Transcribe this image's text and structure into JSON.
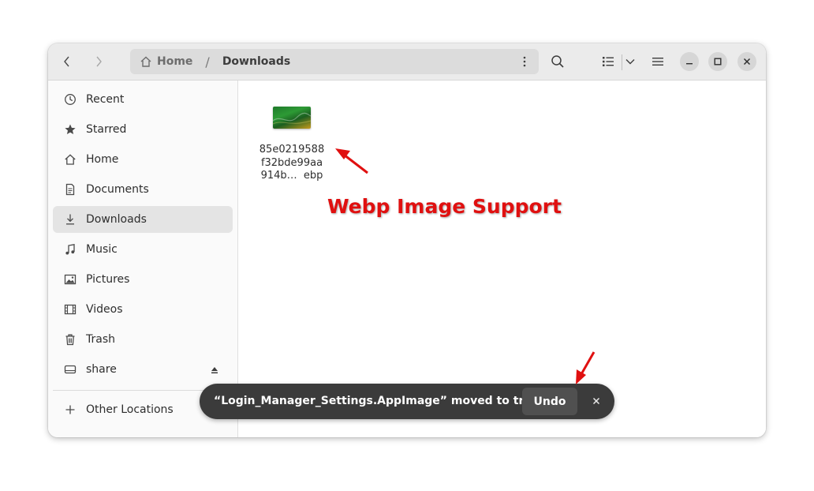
{
  "header": {
    "back_icon": "chevron-left-icon",
    "forward_icon": "chevron-right-icon",
    "breadcrumb": {
      "home": "Home",
      "separator": "/",
      "current": "Downloads"
    },
    "path_menu_icon": "vertical-dots-icon",
    "search_icon": "search-icon",
    "view_icon": "list-view-icon",
    "view_options_icon": "chevron-down-icon",
    "menu_icon": "hamburger-menu-icon",
    "window_controls": [
      "minimize",
      "maximize",
      "close"
    ]
  },
  "sidebar": {
    "items": [
      {
        "label": "Recent",
        "icon": "clock-icon"
      },
      {
        "label": "Starred",
        "icon": "star-icon"
      },
      {
        "label": "Home",
        "icon": "home-icon"
      },
      {
        "label": "Documents",
        "icon": "document-icon"
      },
      {
        "label": "Downloads",
        "icon": "download-icon",
        "active": true
      },
      {
        "label": "Music",
        "icon": "music-note-icon"
      },
      {
        "label": "Pictures",
        "icon": "picture-icon"
      },
      {
        "label": "Videos",
        "icon": "film-icon"
      },
      {
        "label": "Trash",
        "icon": "trash-icon"
      },
      {
        "label": "share",
        "icon": "drive-icon",
        "eject_icon": "eject-icon"
      }
    ],
    "other_locations": {
      "label": "Other Locations",
      "icon": "plus-icon"
    }
  },
  "files": [
    {
      "name": "85e0219588\nf32bde99aa\n914b…  ebp",
      "icon": "webp-thumbnail"
    }
  ],
  "toast": {
    "message": "“Login_Manager_Settings.AppImage” moved to trash",
    "undo_label": "Undo",
    "close_icon": "close-icon"
  },
  "annotation": {
    "text": "Webp Image Support",
    "color": "#e01010"
  }
}
